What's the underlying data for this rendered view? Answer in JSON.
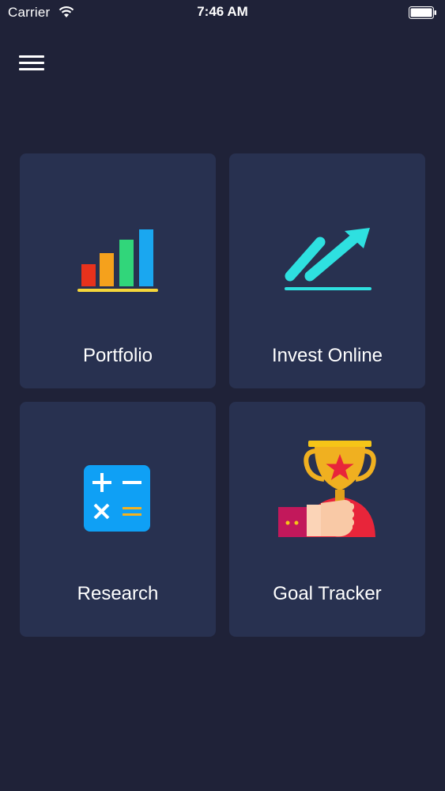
{
  "status_bar": {
    "carrier": "Carrier",
    "time": "7:46 AM",
    "icons": [
      "wifi-icon",
      "battery-icon"
    ]
  },
  "header": {
    "menu_icon": "hamburger-menu-icon"
  },
  "tiles": [
    {
      "label": "Portfolio",
      "icon": "bar-chart-icon"
    },
    {
      "label": "Invest Online",
      "icon": "trend-arrow-icon"
    },
    {
      "label": "Research",
      "icon": "calculator-icon"
    },
    {
      "label": "Goal Tracker",
      "icon": "trophy-icon"
    }
  ],
  "colors": {
    "background": "#1f2238",
    "tile": "#283150",
    "accent_cyan": "#2ee0e0",
    "calculator_blue": "#0fa0f5",
    "trophy_gold": "#f0b020",
    "red": "#e8253a"
  }
}
